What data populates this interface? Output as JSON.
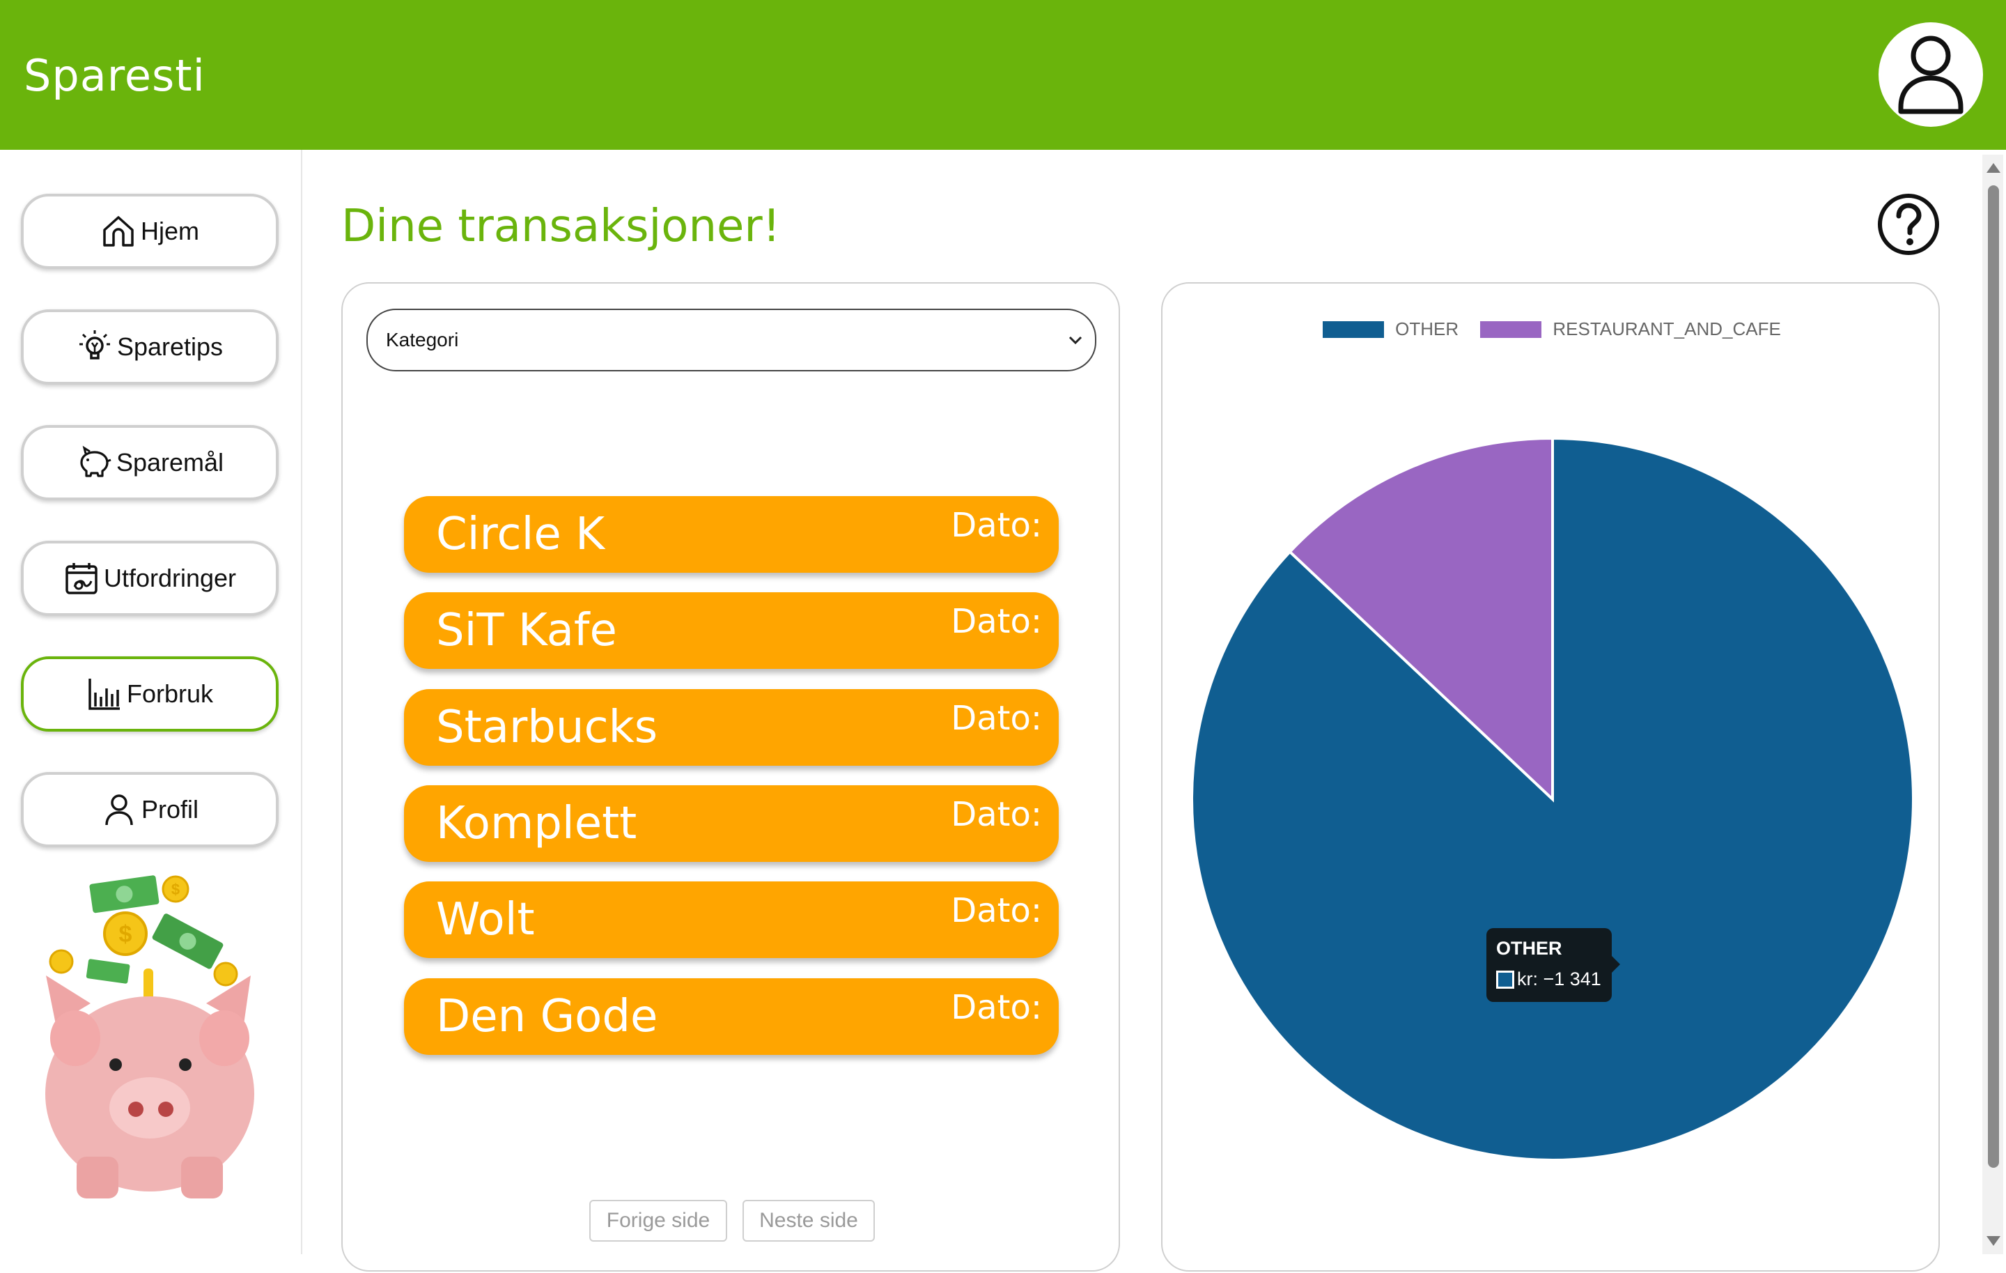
{
  "header": {
    "app_title": "Sparesti"
  },
  "sidebar": {
    "items": [
      {
        "label": "Hjem",
        "icon": "home-icon",
        "active": false
      },
      {
        "label": "Sparetips",
        "icon": "lightbulb-icon",
        "active": false
      },
      {
        "label": "Sparemål",
        "icon": "piggy-bank-icon",
        "active": false
      },
      {
        "label": "Utfordringer",
        "icon": "calendar-challenge-icon",
        "active": true
      },
      {
        "label": "Forbruk",
        "icon": "bar-chart-icon",
        "active": true
      },
      {
        "label": "Profil",
        "icon": "user-icon",
        "active": false
      }
    ]
  },
  "main": {
    "title": "Dine transaksjoner!",
    "filter": {
      "selected": "Kategori"
    },
    "transactions": [
      {
        "name": "Circle K",
        "date_label": "Dato:"
      },
      {
        "name": "SiT Kafe",
        "date_label": "Dato:"
      },
      {
        "name": "Starbucks",
        "date_label": "Dato:"
      },
      {
        "name": "Komplett",
        "date_label": "Dato:"
      },
      {
        "name": "Wolt",
        "date_label": "Dato:"
      },
      {
        "name": "Den Gode",
        "date_label": "Dato:"
      }
    ],
    "pagination": {
      "prev": "Forige side",
      "next": "Neste side"
    }
  },
  "colors": {
    "brand_green": "#6ab40c",
    "transaction_orange": "#ffa500",
    "other_blue": "#105e91",
    "restaurant_purple": "#9966c2"
  },
  "chart_data": {
    "type": "pie",
    "legend_position": "top",
    "categories": [
      "OTHER",
      "RESTAURANT_AND_CAFE"
    ],
    "values": [
      -1341,
      -200
    ],
    "colors": [
      "#105e91",
      "#9966c2"
    ],
    "tooltip": {
      "title": "OTHER",
      "value_text": "kr: −1 341"
    }
  }
}
